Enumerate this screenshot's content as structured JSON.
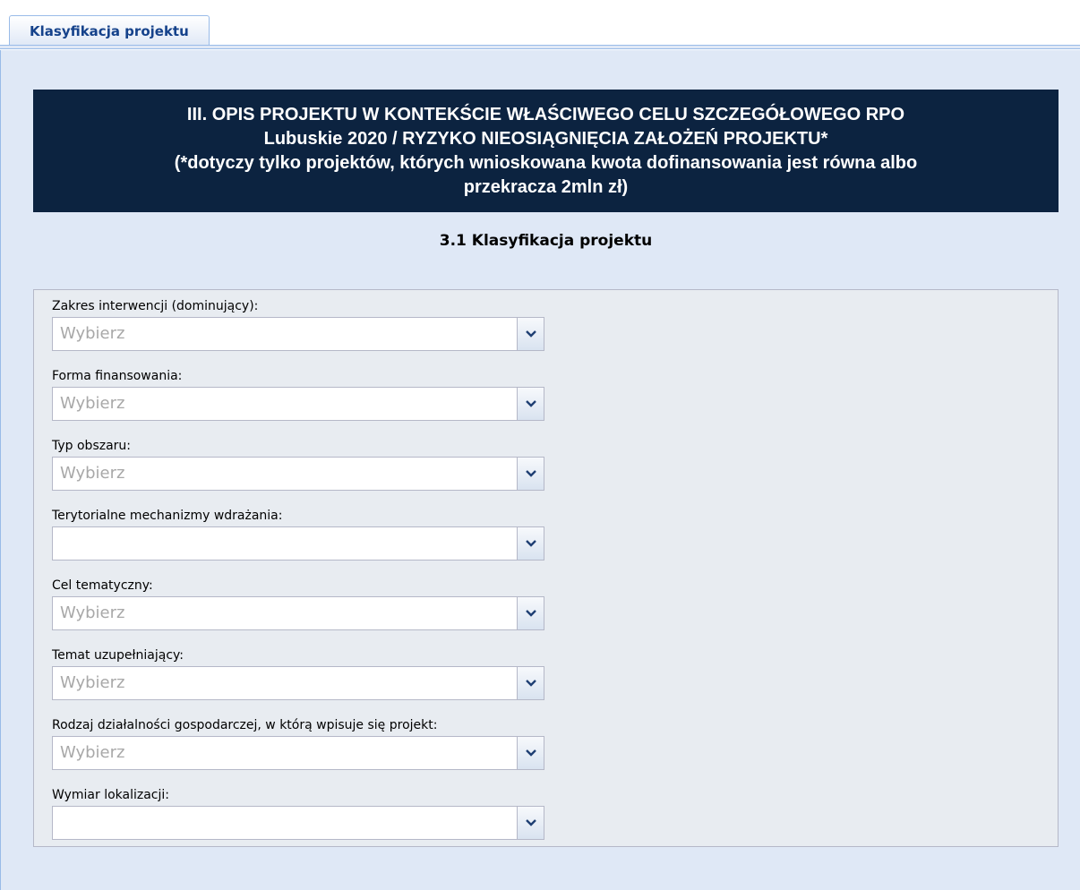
{
  "tabs": [
    {
      "label": "Klasyfikacja projektu"
    }
  ],
  "section_header": {
    "line1": "III. OPIS PROJEKTU W KONTEKŚCIE WŁAŚCIWEGO CELU SZCZEGÓŁOWEGO RPO",
    "line2": "Lubuskie 2020 / RYZYKO NIEOSIĄGNIĘCIA ZAŁOŻEŃ PROJEKTU*",
    "line3": "(*dotyczy tylko projektów, których wnioskowana kwota dofinansowania jest równa albo",
    "line4": "przekracza 2mln zł)"
  },
  "subsection_title": "3.1 Klasyfikacja projektu",
  "fields": [
    {
      "label": "Zakres interwencji (dominujący):",
      "value": "Wybierz"
    },
    {
      "label": "Forma finansowania:",
      "value": "Wybierz"
    },
    {
      "label": "Typ obszaru:",
      "value": "Wybierz"
    },
    {
      "label": "Terytorialne mechanizmy wdrażania:",
      "value": ""
    },
    {
      "label": "Cel tematyczny:",
      "value": "Wybierz"
    },
    {
      "label": "Temat uzupełniający:",
      "value": "Wybierz"
    },
    {
      "label": "Rodzaj działalności gospodarczej, w którą wpisuje się projekt:",
      "value": "Wybierz"
    },
    {
      "label": "Wymiar lokalizacji:",
      "value": ""
    }
  ],
  "icons": {
    "combo_trigger": "chevron-down-icon"
  }
}
